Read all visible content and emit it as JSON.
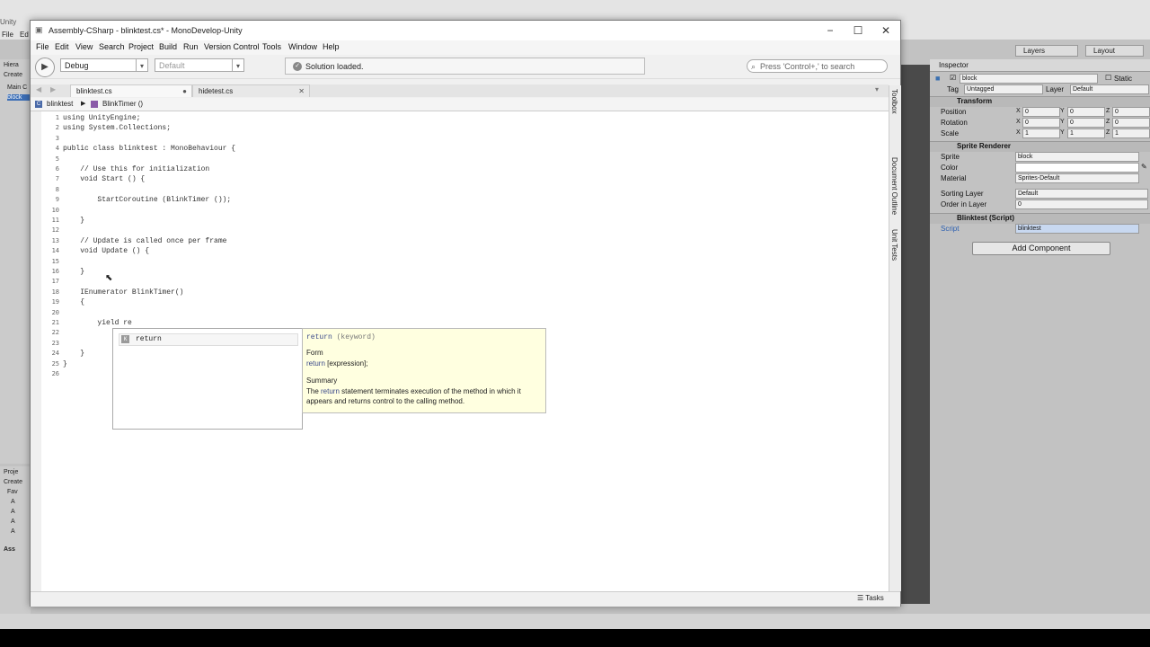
{
  "unity": {
    "title": "Unity",
    "menu": [
      "File",
      "Ed"
    ],
    "layers_label": "Layers",
    "layout_label": "Layout",
    "left_panel": {
      "hierarchy_tab": "Hiera",
      "create": "Create",
      "main_camera": "Main C",
      "block": "block",
      "project_tab": "Proje",
      "create2": "Create",
      "favorites": "Fav",
      "assets": "Ass",
      "items": [
        "A",
        "A",
        "A",
        "A"
      ]
    },
    "inspector": {
      "tab": "Inspector",
      "object_name": "block",
      "static_label": "Static",
      "tag_label": "Tag",
      "tag_value": "Untagged",
      "layer_label": "Layer",
      "layer_value": "Default",
      "transform": {
        "header": "Transform",
        "position_label": "Position",
        "rotation_label": "Rotation",
        "scale_label": "Scale",
        "x": "X",
        "y": "Y",
        "z": "Z",
        "position": [
          "0",
          "0",
          "0"
        ],
        "rotation": [
          "0",
          "0",
          "0"
        ],
        "scale": [
          "1",
          "1",
          "1"
        ]
      },
      "sprite_renderer": {
        "header": "Sprite Renderer",
        "sprite_label": "Sprite",
        "sprite_value": "block",
        "color_label": "Color",
        "material_label": "Material",
        "material_value": "Sprites-Default",
        "sorting_layer_label": "Sorting Layer",
        "sorting_layer_value": "Default",
        "order_label": "Order in Layer",
        "order_value": "0"
      },
      "script_component": {
        "header": "Blinktest (Script)",
        "script_label": "Script",
        "script_value": "blinktest"
      },
      "add_component": "Add Component"
    }
  },
  "md": {
    "window_title": "Assembly-CSharp - blinktest.cs* - MonoDevelop-Unity",
    "menu": [
      "File",
      "Edit",
      "View",
      "Search",
      "Project",
      "Build",
      "Run",
      "Version Control",
      "Tools",
      "Window",
      "Help"
    ],
    "config": "Debug",
    "platform": "Default",
    "status": "Solution loaded.",
    "search_placeholder": "Press 'Control+,' to search",
    "tabs": [
      "blinktest.cs",
      "hidetest.cs"
    ],
    "breadcrumb": [
      "blinktest",
      "BlinkTimer ()"
    ],
    "right_pad": [
      "Toolbox",
      "Document Outline",
      "Unit Tests"
    ],
    "tasks": "Tasks",
    "lines": [
      {
        "n": "1",
        "t": "using UnityEngine;",
        "c": "kw"
      },
      {
        "n": "2",
        "t": "using System.Collections;",
        "c": "kw"
      },
      {
        "n": "3",
        "t": "",
        "c": ""
      },
      {
        "n": "4",
        "t": "public class blinktest : MonoBehaviour {",
        "c": "kw"
      },
      {
        "n": "5",
        "t": "",
        "c": ""
      },
      {
        "n": "6",
        "t": "    // Use this for initialization",
        "c": "cm"
      },
      {
        "n": "7",
        "t": "    void Start () {",
        "c": ""
      },
      {
        "n": "8",
        "t": "",
        "c": ""
      },
      {
        "n": "9",
        "t": "        StartCoroutine (BlinkTimer ());",
        "c": ""
      },
      {
        "n": "10",
        "t": "",
        "c": ""
      },
      {
        "n": "11",
        "t": "    }",
        "c": ""
      },
      {
        "n": "12",
        "t": "",
        "c": ""
      },
      {
        "n": "13",
        "t": "    // Update is called once per frame",
        "c": "cm"
      },
      {
        "n": "14",
        "t": "    void Update () {",
        "c": ""
      },
      {
        "n": "15",
        "t": "",
        "c": ""
      },
      {
        "n": "16",
        "t": "    }",
        "c": ""
      },
      {
        "n": "17",
        "t": "",
        "c": ""
      },
      {
        "n": "18",
        "t": "    IEnumerator BlinkTimer()",
        "c": ""
      },
      {
        "n": "19",
        "t": "    {",
        "c": ""
      },
      {
        "n": "20",
        "t": "",
        "c": ""
      },
      {
        "n": "21",
        "t": "        yield re",
        "c": ""
      },
      {
        "n": "22",
        "t": "",
        "c": ""
      },
      {
        "n": "23",
        "t": "",
        "c": ""
      },
      {
        "n": "24",
        "t": "    }",
        "c": ""
      },
      {
        "n": "25",
        "t": "}",
        "c": ""
      },
      {
        "n": "26",
        "t": "",
        "c": ""
      }
    ],
    "completion": {
      "item": "return",
      "tooltip_keyword": "return",
      "tooltip_kind": "(keyword)",
      "form_label": "Form",
      "form_kw": "return",
      "form_rest": " [expression];",
      "summary_label": "Summary",
      "summary_pre": "The ",
      "summary_kw": "return",
      "summary_post": " statement terminates execution of the method in which it",
      "summary_line2": "appears and returns control to the calling method."
    }
  }
}
